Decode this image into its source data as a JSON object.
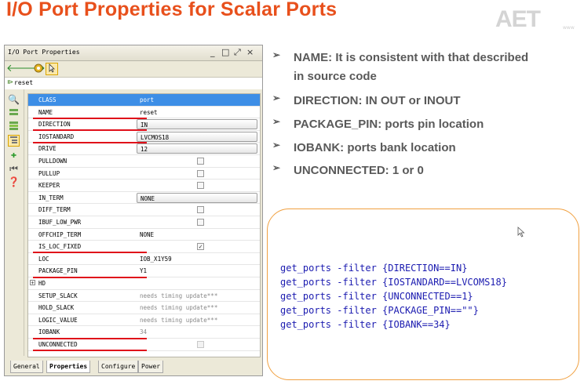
{
  "slide": {
    "title": "I/O Port Properties for Scalar Ports",
    "logo_text": "AET",
    "logo_url": "www"
  },
  "panel": {
    "title": "I/O Port Properties",
    "window_buttons": [
      "_",
      "□",
      "⤢",
      "×"
    ],
    "object_name": "reset",
    "properties": [
      {
        "name": "CLASS",
        "value": "port",
        "kind": "text",
        "selected": true
      },
      {
        "name": "NAME",
        "value": "reset",
        "kind": "text",
        "underline": true
      },
      {
        "name": "DIRECTION",
        "value": "IN",
        "kind": "combo",
        "underline": true
      },
      {
        "name": "IOSTANDARD",
        "value": "LVCMOS18",
        "kind": "combo",
        "underline": true
      },
      {
        "name": "DRIVE",
        "value": "12",
        "kind": "combo"
      },
      {
        "name": "PULLDOWN",
        "value": "",
        "kind": "check"
      },
      {
        "name": "PULLUP",
        "value": "",
        "kind": "check"
      },
      {
        "name": "KEEPER",
        "value": "",
        "kind": "check"
      },
      {
        "name": "IN_TERM",
        "value": "NONE",
        "kind": "combo"
      },
      {
        "name": "DIFF_TERM",
        "value": "",
        "kind": "check"
      },
      {
        "name": "IBUF_LOW_PWR",
        "value": "",
        "kind": "check"
      },
      {
        "name": "OFFCHIP_TERM",
        "value": "NONE",
        "kind": "text"
      },
      {
        "name": "IS_LOC_FIXED",
        "value": "✓",
        "kind": "check",
        "underline": true
      },
      {
        "name": "LOC",
        "value": "IOB_X1Y59",
        "kind": "text"
      },
      {
        "name": "PACKAGE_PIN",
        "value": "Y1",
        "kind": "text",
        "underline": true
      },
      {
        "name": "HD",
        "value": "",
        "kind": "group"
      },
      {
        "name": "SETUP_SLACK",
        "value": "needs timing update***",
        "kind": "grey"
      },
      {
        "name": "HOLD_SLACK",
        "value": "needs timing update***",
        "kind": "grey"
      },
      {
        "name": "LOGIC_VALUE",
        "value": "needs timing update***",
        "kind": "grey"
      },
      {
        "name": "IOBANK",
        "value": "34",
        "kind": "grey",
        "underline": true
      },
      {
        "name": "UNCONNECTED",
        "value": "",
        "kind": "check-disabled",
        "underline": true
      }
    ],
    "tabs": [
      {
        "label": "General"
      },
      {
        "label": "Properties",
        "active": true
      },
      {
        "label": "Configure"
      },
      {
        "label": "Power"
      }
    ]
  },
  "bullets": [
    {
      "text": "NAME: It is consistent with that described in source code"
    },
    {
      "text": "DIRECTION: IN OUT or INOUT"
    },
    {
      "text": "PACKAGE_PIN: ports pin location"
    },
    {
      "text": "IOBANK: ports bank location"
    },
    {
      "text": "UNCONNECTED: 1 or 0"
    }
  ],
  "code_lines": [
    "get_ports -filter {DIRECTION==IN}",
    "get_ports -filter {IOSTANDARD==LVCOMS18}",
    "get_ports -filter {UNCONNECTED==1}",
    "get_ports -filter {PACKAGE_PIN==\"\"}",
    "get_ports -filter {IOBANK==34}"
  ],
  "colors": {
    "title": "#e8501c",
    "code": "#1b1bb0",
    "box_border": "#f0a040",
    "underline": "#e0101a",
    "selection": "#3d8ee6"
  }
}
